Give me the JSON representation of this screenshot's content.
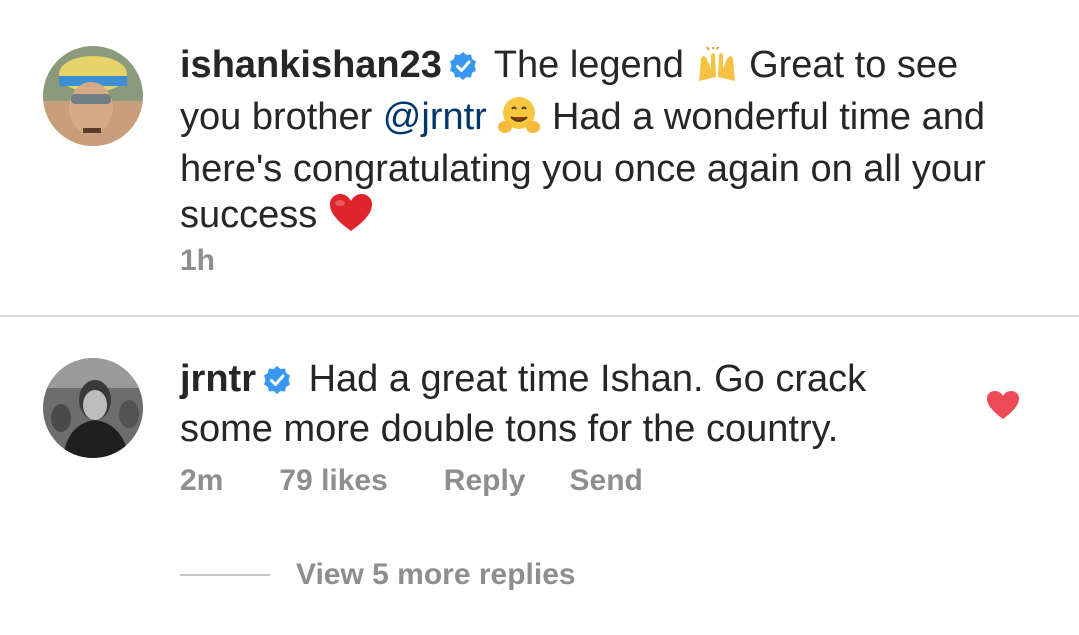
{
  "comments": [
    {
      "username": "ishankishan23",
      "avatar": "avatar-photo",
      "verified": true,
      "text_part1": "The legend",
      "text_part2": "Great to see you brother",
      "mention": "@jrntr",
      "text_part3": "Had a wonderful time and here's congratulating you once again on all your success",
      "emojis": [
        "raising-hands-icon",
        "hugging-face-icon",
        "red-heart-icon"
      ],
      "time": "1h"
    },
    {
      "username": "jrntr",
      "avatar": "avatar-photo",
      "verified": true,
      "text": "Had a great time Ishan. Go crack some more double tons for the country.",
      "time": "2m",
      "likes": "79 likes",
      "reply_label": "Reply",
      "send_label": "Send",
      "liked": true
    }
  ],
  "view_replies_label": "View 5 more replies",
  "colors": {
    "text": "#262626",
    "meta": "#8e8e8e",
    "mention": "#00376b",
    "verified": "#3897f0",
    "like": "#ed4956",
    "divider": "#dbdbdb"
  }
}
